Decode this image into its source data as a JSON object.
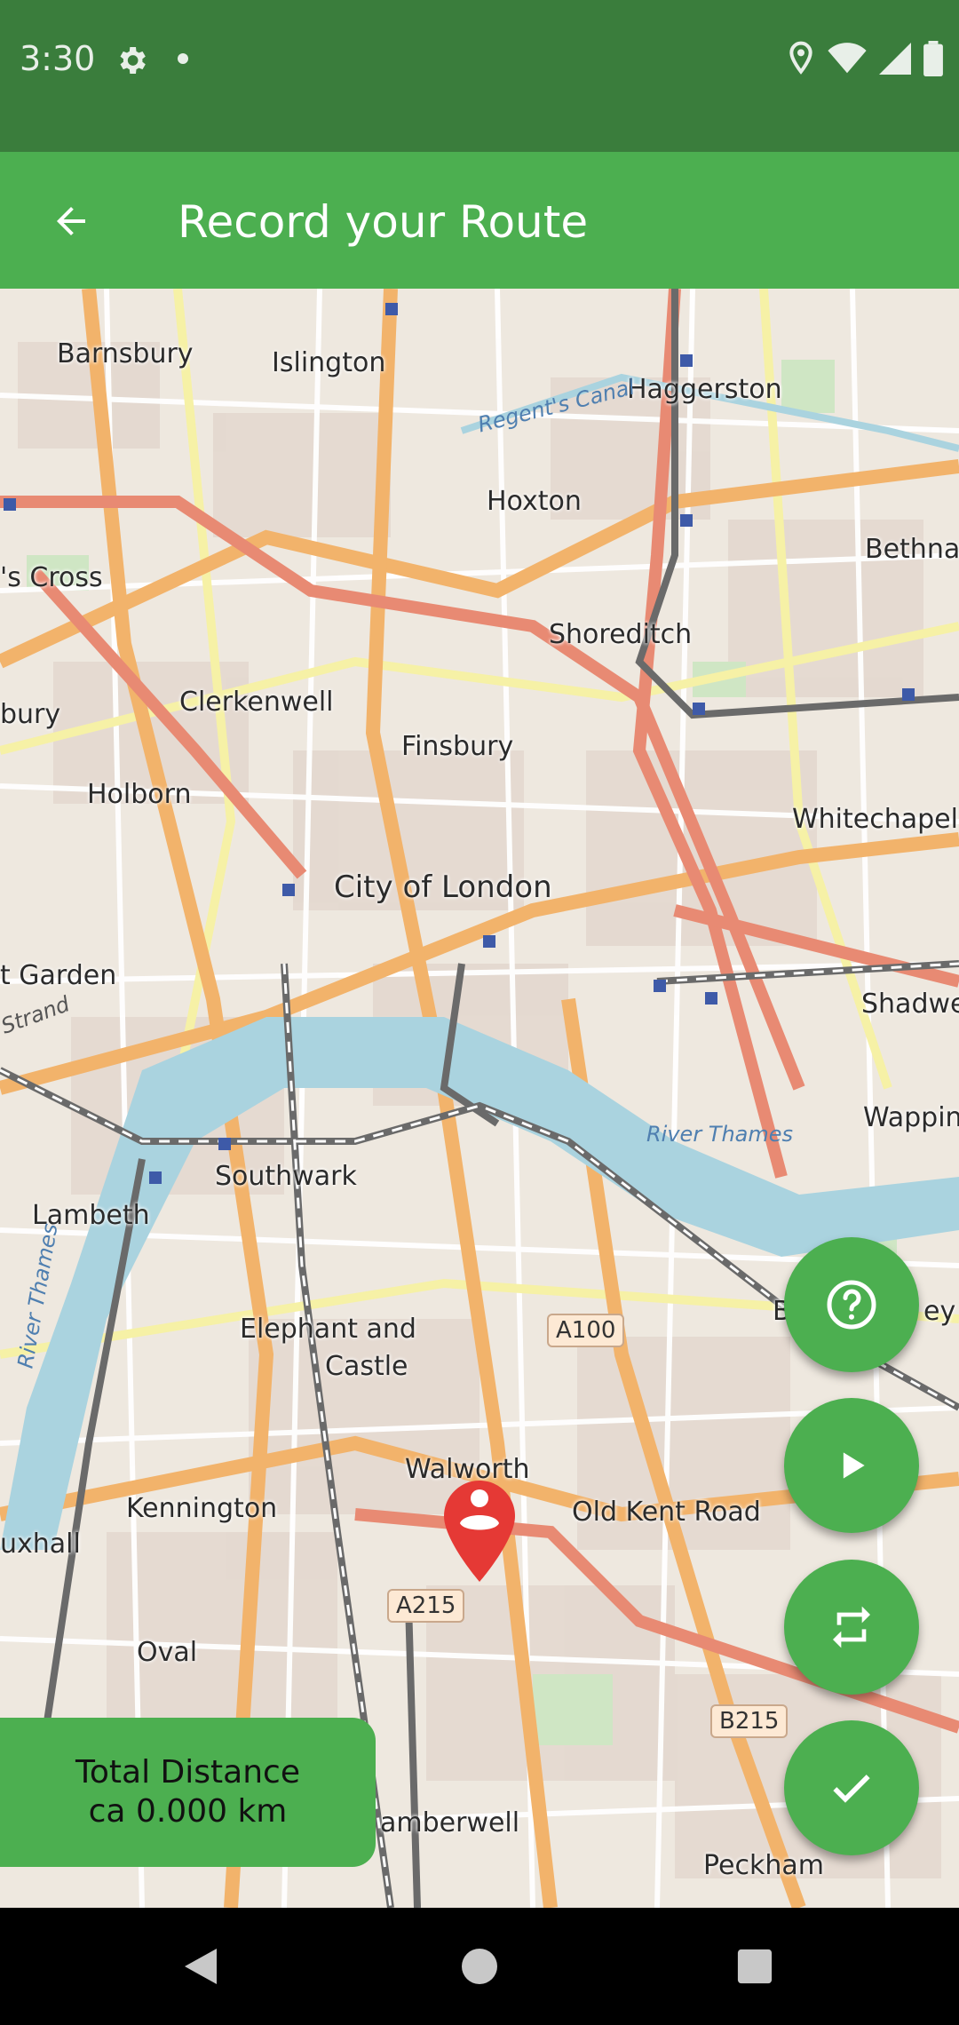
{
  "status_bar": {
    "time": "3:30",
    "icons": [
      "gear-icon",
      "dot",
      "location-icon",
      "wifi-icon",
      "signal-icon",
      "battery-icon"
    ]
  },
  "app_bar": {
    "title": "Record your Route",
    "back_icon": "arrow-left-icon"
  },
  "map": {
    "labels": {
      "barnsbury": "Barnsbury",
      "islington": "Islington",
      "haggerston": "Haggerston",
      "hoxton": "Hoxton",
      "bethnal": "Bethna",
      "kings_cross": "'s Cross",
      "shoreditch": "Shoreditch",
      "clerkenwell": "Clerkenwell",
      "bury": "bury",
      "finsbury": "Finsbury",
      "holborn": "Holborn",
      "whitechapel": "Whitechapel",
      "city_of_london": "City of London",
      "covent_garden": "t Garden",
      "shadwell": "Shadwe",
      "wapping": "Wappin",
      "southwark": "Southwark",
      "lambeth": "Lambeth",
      "elephant_castle_1": "Elephant and",
      "elephant_castle_2": "Castle",
      "bermondsey": "B",
      "bermondsey_2": "ey",
      "walworth": "Walworth",
      "kennington": "Kennington",
      "old_kent_road": "Old Kent Road",
      "vauxhall": "uxhall",
      "oval": "Oval",
      "camberwell": "amberwell",
      "peckham": "Peckham"
    },
    "water_labels": {
      "regents_canal": "Regent's Canal",
      "river_thames": "River Thames",
      "river_thames_vertical": "River Thames",
      "strand": "Strand"
    },
    "road_shields": {
      "a100": "A100",
      "a215": "A215",
      "b215": "B215"
    }
  },
  "fabs": {
    "help_icon": "help-circle-icon",
    "play_icon": "play-icon",
    "repeat_icon": "repeat-icon",
    "check_icon": "check-icon"
  },
  "distance": {
    "label": "Total Distance",
    "value": "ca 0.000 km"
  },
  "colors": {
    "status_bar": "#3a7d3c",
    "app_bar": "#4caf50",
    "fab": "#4caf50",
    "marker": "#e53935"
  }
}
